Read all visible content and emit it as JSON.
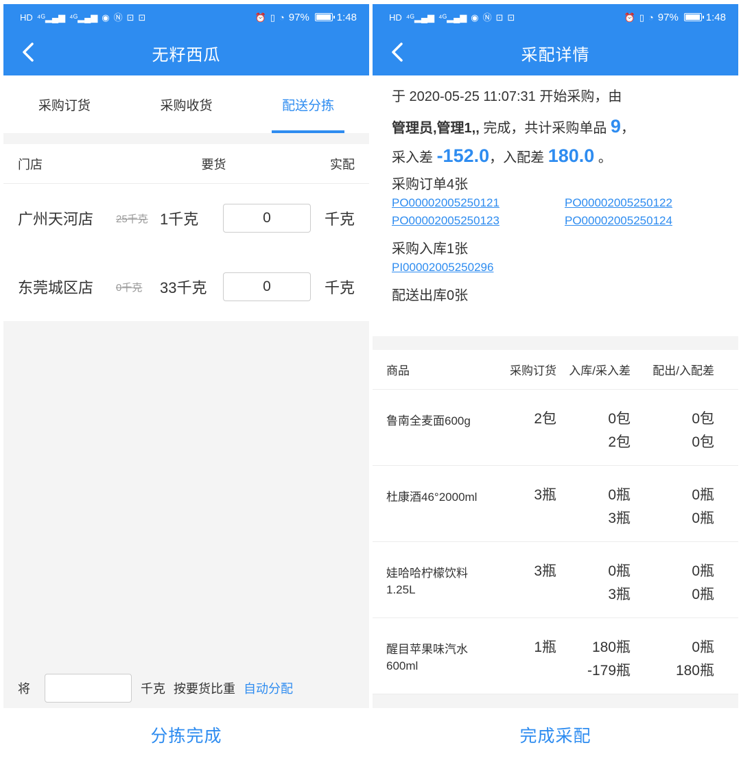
{
  "status": {
    "left_icons": [
      "HD",
      "4G",
      "4G",
      "eye",
      "N",
      "msg",
      "msg"
    ],
    "battery": "97%",
    "battery_level": 0.97,
    "time": "1:48"
  },
  "left": {
    "title": "无籽西瓜",
    "tabs": [
      {
        "label": "采购订货",
        "active": false
      },
      {
        "label": "采购收货",
        "active": false
      },
      {
        "label": "配送分拣",
        "active": true
      }
    ],
    "headers": {
      "store": "门店",
      "request": "要货",
      "actual": "实配"
    },
    "rows": [
      {
        "store": "广州天河店",
        "old": "25千克",
        "request": "1千克",
        "qty": "0",
        "unit": "千克"
      },
      {
        "store": "东莞城区店",
        "old": "0千克",
        "request": "33千克",
        "qty": "0",
        "unit": "千克"
      }
    ],
    "allocate": {
      "prefix": "将",
      "unit": "千克",
      "by": "按要货比重",
      "link": "自动分配"
    },
    "button": "分拣完成"
  },
  "right": {
    "title": "采配详情",
    "summary": {
      "line1": "于 2020-05-25 11:07:31 开始采购，由",
      "operator": "管理员,管理1,,",
      "done": " 完成，共计采购单品 ",
      "count": "9",
      "comma": "，",
      "diff_in_label": "采入差 ",
      "diff_in": "-152.0",
      "diff_out_label": "，入配差 ",
      "diff_out": "180.0",
      "period": " 。"
    },
    "po_title": "采购订单4张",
    "po_links": [
      "PO00002005250121",
      "PO00002005250122",
      "PO00002005250123",
      "PO00002005250124"
    ],
    "pi_title": "采购入库1张",
    "pi_links": [
      "PI00002005250296"
    ],
    "out_title": "配送出库0张",
    "headers": {
      "product": "商品",
      "order": "采购订货",
      "in": "入库/采入差",
      "out": "配出/入配差"
    },
    "products": [
      {
        "name": "鲁南全麦面600g",
        "order": "2包",
        "in1": "0包",
        "in2": "2包",
        "out1": "0包",
        "out2": "0包"
      },
      {
        "name": "杜康酒46°2000ml",
        "order": "3瓶",
        "in1": "0瓶",
        "in2": "3瓶",
        "out1": "0瓶",
        "out2": "0瓶"
      },
      {
        "name": "娃哈哈柠檬饮料1.25L",
        "order": "3瓶",
        "in1": "0瓶",
        "in2": "3瓶",
        "out1": "0瓶",
        "out2": "0瓶"
      },
      {
        "name": "醒目苹果味汽水600ml",
        "order": "1瓶",
        "in1": "180瓶",
        "in2": "-179瓶",
        "out1": "0瓶",
        "out2": "180瓶"
      }
    ],
    "button": "完成采配"
  }
}
